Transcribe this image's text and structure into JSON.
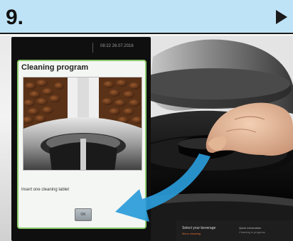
{
  "step": {
    "number": "9.",
    "next_icon": "play-triangle-icon"
  },
  "device": {
    "status": {
      "datetime": "08:22  26.07.2016"
    },
    "screen": {
      "title": "Cleaning program",
      "image": "coffee-beans-grinder-photo",
      "instruction": "Insert one cleaning tablet",
      "ok_label": "OK"
    }
  },
  "machine_display": {
    "left_title": "Select your beverage",
    "left_sub": "Menu cleaning",
    "right_title": "Quick information",
    "right_sub": "Cleaning in progress"
  },
  "colors": {
    "header_bg": "#bfe3f6",
    "screen_border": "#8ccc6e",
    "pointer_arrow": "#2a9bd9"
  }
}
